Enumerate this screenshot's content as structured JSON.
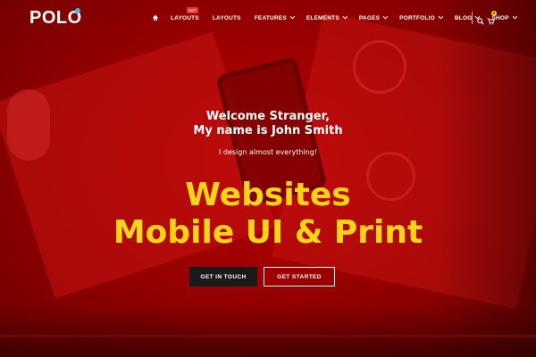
{
  "brand": {
    "logo_text": "POLO",
    "accent_color": "#f7d417",
    "logo_dot_color": "#2ec4e6"
  },
  "nav": {
    "home_icon": "home-icon",
    "items": [
      {
        "label": "LAYOUTS",
        "badge": "HOT",
        "dropdown": false
      },
      {
        "label": "LAYOUTS",
        "dropdown": false
      },
      {
        "label": "FEATURES",
        "dropdown": true
      },
      {
        "label": "ELEMENTS",
        "dropdown": true
      },
      {
        "label": "PAGES",
        "dropdown": true
      },
      {
        "label": "PORTFOLIO",
        "dropdown": true
      },
      {
        "label": "BLOG",
        "dropdown": true
      },
      {
        "label": "SHOP",
        "dropdown": true
      }
    ],
    "search_icon": "search-icon",
    "cart_icon": "cart-icon",
    "cart_count": "0"
  },
  "hero": {
    "welcome_line1": "Welcome Stranger,",
    "welcome_line2": "My name is John Smith",
    "tagline": "I design almost everything!",
    "headline_line1": "Websites",
    "headline_line2": "Mobile UI & Print",
    "primary_button": "GET IN TOUCH",
    "secondary_button": "GET STARTED",
    "background_tint": "#b80000"
  }
}
